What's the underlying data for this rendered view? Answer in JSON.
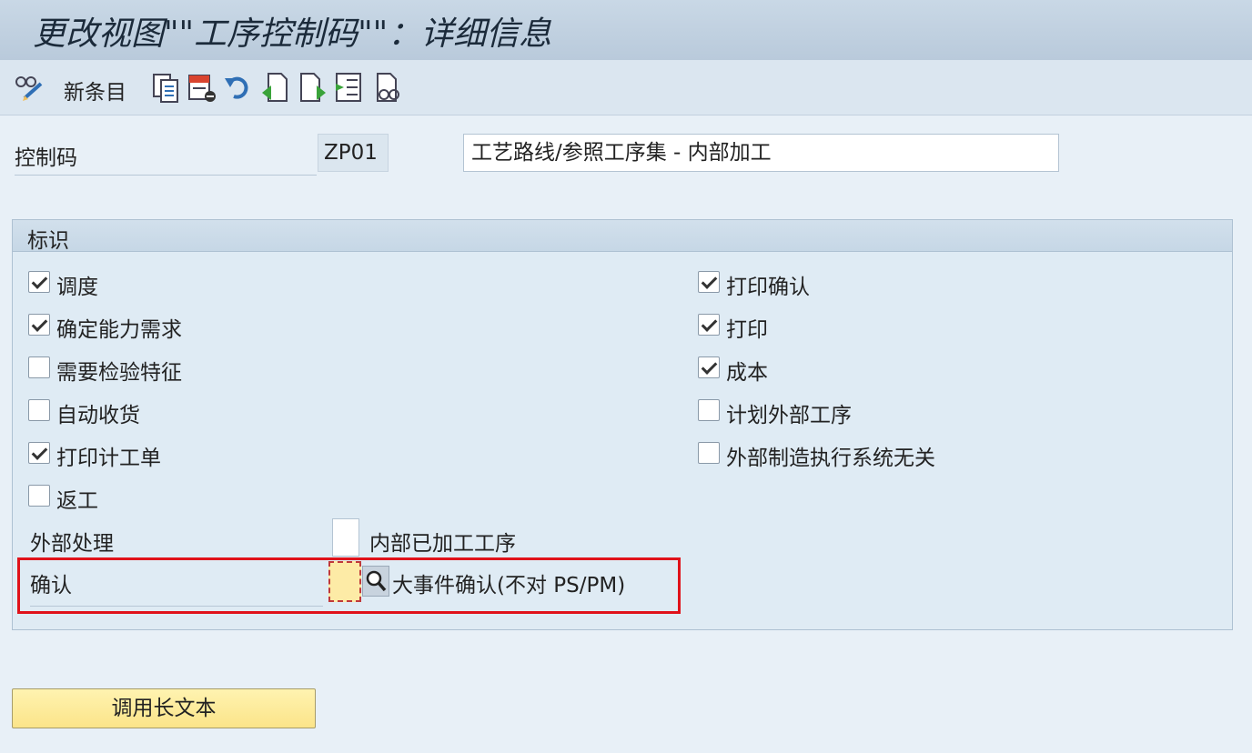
{
  "window": {
    "title": "更改视图\"\"工序控制码\"\"：详细信息"
  },
  "toolbar": {
    "new_entry_label": "新条目",
    "icons": [
      "display-change-icon",
      "copy-icon",
      "delete-icon",
      "undo-icon",
      "previous-entry-icon",
      "next-entry-icon",
      "select-all-icon",
      "print-icon"
    ]
  },
  "header": {
    "control_key_label": "控制码",
    "control_key_value": "ZP01",
    "control_key_description": "工艺路线/参照工序集 - 内部加工"
  },
  "group": {
    "title": "标识",
    "left_checks": [
      {
        "label": "调度",
        "checked": true
      },
      {
        "label": "确定能力需求",
        "checked": true
      },
      {
        "label": "需要检验特征",
        "checked": false
      },
      {
        "label": "自动收货",
        "checked": false
      },
      {
        "label": "打印计工单",
        "checked": true
      },
      {
        "label": "返工",
        "checked": false
      }
    ],
    "right_checks": [
      {
        "label": "打印确认",
        "checked": true
      },
      {
        "label": "打印",
        "checked": true
      },
      {
        "label": "成本",
        "checked": true
      },
      {
        "label": "计划外部工序",
        "checked": false
      },
      {
        "label": "外部制造执行系统无关",
        "checked": false
      }
    ],
    "external_processing_label": "外部处理",
    "external_processing_value": "",
    "external_processing_text": "内部已加工工序",
    "confirmation_label": "确认",
    "confirmation_value": "",
    "confirmation_text": "大事件确认(不对 PS/PM)"
  },
  "buttons": {
    "long_text": "调用长文本"
  },
  "colors": {
    "highlight_border": "#e0121a",
    "focus_field": "#fdeba6",
    "button_bg": "#fbe489"
  }
}
